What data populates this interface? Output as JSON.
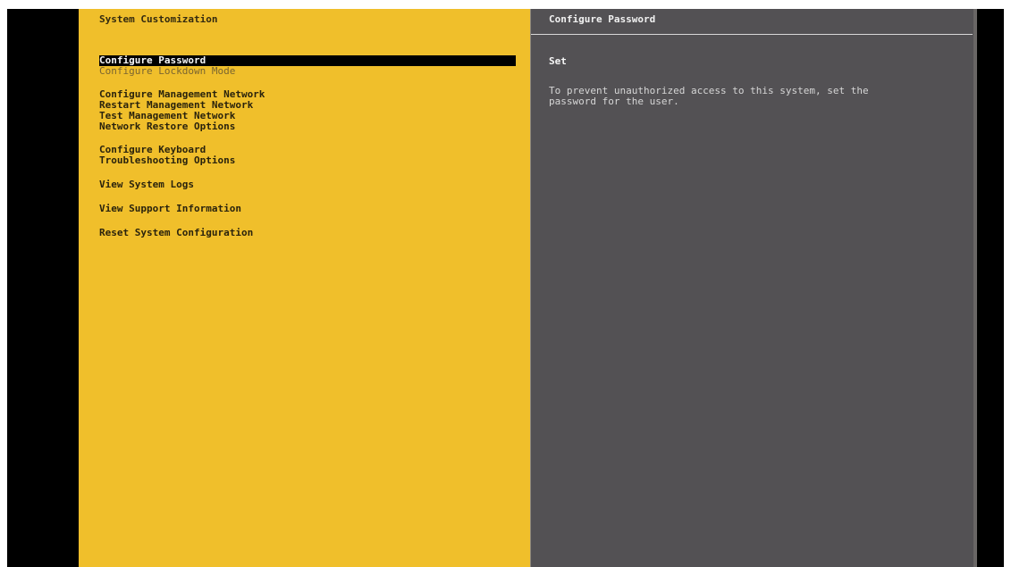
{
  "left_panel": {
    "title": "System Customization",
    "menu": [
      {
        "label": "Configure Password",
        "selected": true
      },
      {
        "label": "Configure Lockdown Mode",
        "dimmed": true
      },
      {
        "label": "Configure Management Network"
      },
      {
        "label": "Restart Management Network"
      },
      {
        "label": "Test Management Network"
      },
      {
        "label": "Network Restore Options"
      },
      {
        "label": "Configure Keyboard"
      },
      {
        "label": "Troubleshooting Options"
      },
      {
        "label": "View System Logs"
      },
      {
        "label": "View Support Information"
      },
      {
        "label": "Reset System Configuration"
      }
    ]
  },
  "right_panel": {
    "title": "Configure Password",
    "status": "Set",
    "description_lines": [
      "To prevent unauthorized access to this system, set the",
      "password for the user."
    ]
  },
  "colors": {
    "left_panel_bg": "#f0bf2b",
    "right_panel_bg": "#535154",
    "selection_bg": "#000000",
    "selection_fg": "#f7f7f7"
  }
}
